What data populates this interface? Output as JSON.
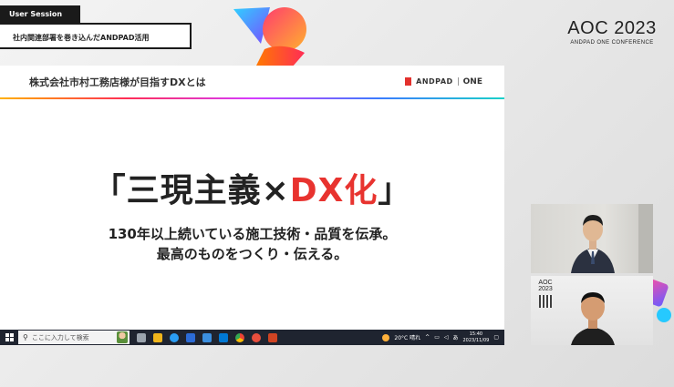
{
  "session": {
    "tag": "User Session",
    "title": "社内関連部署を巻き込んだANDPAD活用"
  },
  "conference_logo": {
    "main": "AOC 2023",
    "sub": "ANDPAD ONE CONFERENCE"
  },
  "slide": {
    "header_title": "株式会社市村工務店様が目指すDXとは",
    "brand_text": "ANDPAD",
    "brand_text2": "ONE",
    "headline_open": "「三現主義×",
    "headline_red": "DX化",
    "headline_close": "」",
    "sub_line1": "130年以上続いている施工技術・品質を伝承。",
    "sub_line2": "最高のものをつくり・伝える。"
  },
  "taskbar": {
    "search_placeholder": "ここに入力して検索",
    "weather": "20°C 晴れ",
    "ime": "あ",
    "time": "15:40",
    "date": "2023/11/09"
  },
  "video2": {
    "logo_top": "AOC",
    "logo_bottom": "2023"
  },
  "colors": {
    "accent_red": "#e8332f",
    "taskbar": "#1f2430",
    "session_tag": "#1a1a1a"
  }
}
